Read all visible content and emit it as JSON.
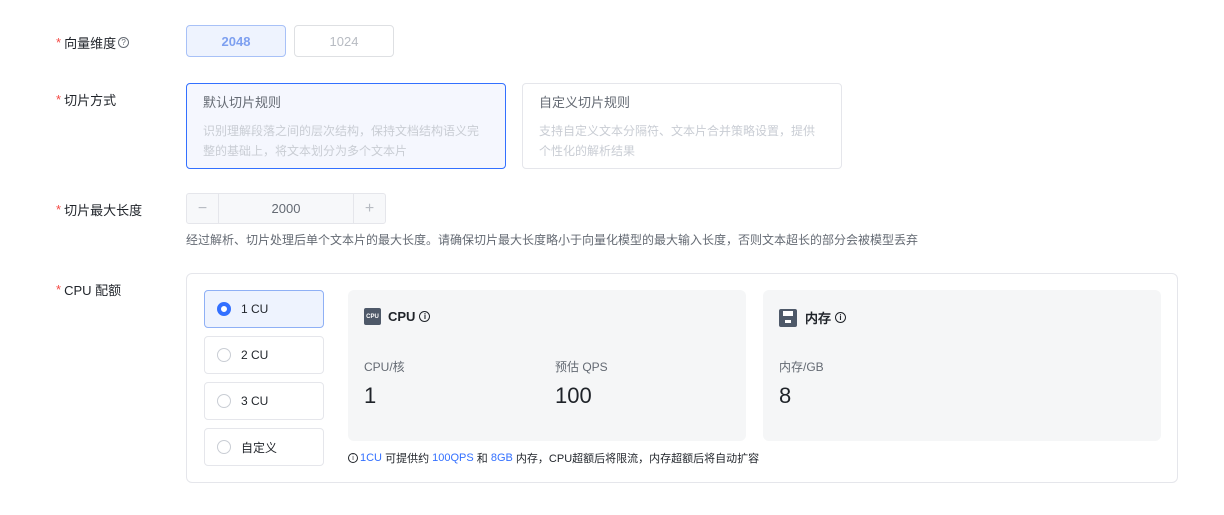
{
  "vector_dim": {
    "label": "向量维度",
    "help_icon": "question-circle-icon",
    "options": [
      "2048",
      "1024"
    ],
    "selected": "2048"
  },
  "slice_method": {
    "label": "切片方式",
    "options": [
      {
        "title": "默认切片规则",
        "desc": "识别理解段落之间的层次结构，保持文档结构语义完整的基础上，将文本划分为多个文本片"
      },
      {
        "title": "自定义切片规则",
        "desc": "支持自定义文本分隔符、文本片合并策略设置，提供个性化的解析结果"
      }
    ],
    "selected": "默认切片规则"
  },
  "slice_max_len": {
    "label": "切片最大长度",
    "value": "2000",
    "minus": "−",
    "plus": "+",
    "hint": "经过解析、切片处理后单个文本片的最大长度。请确保切片最大长度略小于向量化模型的最大输入长度，否则文本超长的部分会被模型丢弃"
  },
  "cpu_quota": {
    "label": "CPU 配额",
    "options": [
      "1 CU",
      "2 CU",
      "3 CU",
      "自定义"
    ],
    "selected": "1 CU",
    "cpu_box": {
      "title": "CPU",
      "chip_text": "CPU",
      "metrics": [
        {
          "label": "CPU/核",
          "value": "1"
        },
        {
          "label": "预估 QPS",
          "value": "100"
        }
      ]
    },
    "mem_box": {
      "title": "内存",
      "metrics": [
        {
          "label": "内存/GB",
          "value": "8"
        }
      ]
    },
    "note": {
      "cu": "1CU",
      "t1": " 可提供约 ",
      "qps": "100QPS",
      "t2": " 和 ",
      "gb": "8GB",
      "t3": " 内存，CPU超额后将限流，内存超额后将自动扩容"
    }
  },
  "colors": {
    "required": "#f54a45",
    "primary": "#3370ff",
    "selected_bg": "#eef3fe"
  }
}
